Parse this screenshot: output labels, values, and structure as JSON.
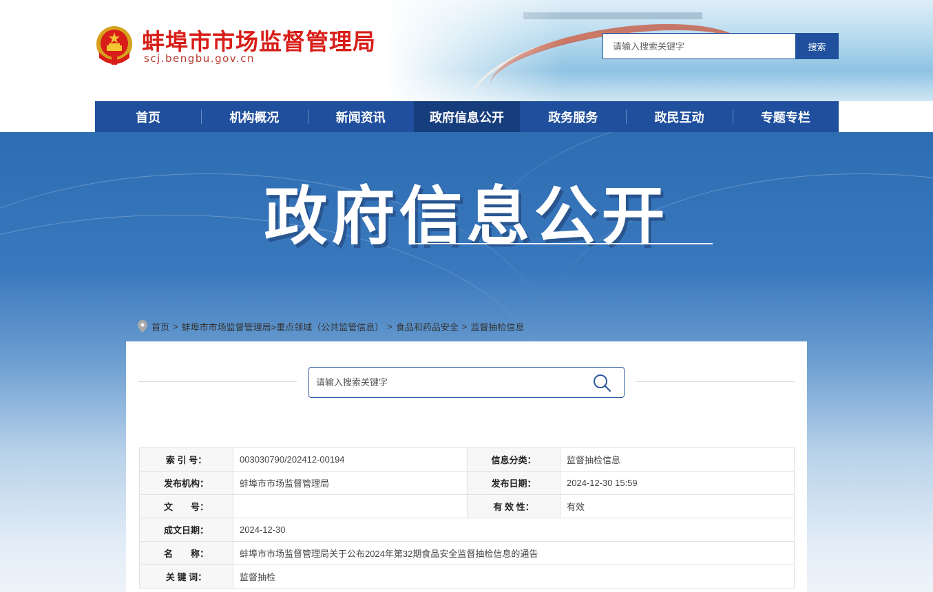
{
  "header": {
    "site_title": "蚌埠市市场监督管理局",
    "site_domain": "scj.bengbu.gov.cn",
    "emblem_icon": "national-emblem-icon",
    "search": {
      "placeholder": "请输入搜索关键字",
      "button_label": "搜索"
    }
  },
  "nav": {
    "items": [
      {
        "label": "首页"
      },
      {
        "label": "机构概况"
      },
      {
        "label": "新闻资讯"
      },
      {
        "label": "政府信息公开"
      },
      {
        "label": "政务服务"
      },
      {
        "label": "政民互动"
      },
      {
        "label": "专题专栏"
      }
    ],
    "active_index": 3
  },
  "banner": {
    "title": "政府信息公开"
  },
  "breadcrumb": {
    "icon": "location-pin-icon",
    "items": [
      {
        "label": "首页"
      },
      {
        "label": "蚌埠市市场监督管理局"
      },
      {
        "label": ">重点领域（公共监管信息）"
      },
      {
        "label": "食品和药品安全"
      },
      {
        "label": "监督抽检信息"
      }
    ],
    "separator": ">"
  },
  "content_search": {
    "placeholder": "请输入搜索关键字",
    "icon": "magnifier-icon"
  },
  "meta_table": {
    "index_no": {
      "label": "索 引 号：",
      "value": "003030790/202412-00194"
    },
    "category": {
      "label": "信息分类：",
      "value": "监督抽检信息"
    },
    "publisher": {
      "label": "发布机构：",
      "value": "蚌埠市市场监督管理局"
    },
    "publish_date": {
      "label": "发布日期：",
      "value": "2024-12-30 15:59"
    },
    "doc_no": {
      "label": "文　　号：",
      "value": ""
    },
    "validity": {
      "label": "有 效 性：",
      "value": "有效"
    },
    "created_date": {
      "label": "成文日期：",
      "value": "2024-12-30"
    },
    "name": {
      "label": "名　　称：",
      "value": "蚌埠市市场监督管理局关于公布2024年第32期食品安全监督抽检信息的通告"
    },
    "keywords": {
      "label": "关 键 词：",
      "value": "监督抽检"
    }
  },
  "colors": {
    "brand_blue": "#1f4f9d",
    "nav_active": "#163d7c",
    "title_red": "#d81e19"
  }
}
